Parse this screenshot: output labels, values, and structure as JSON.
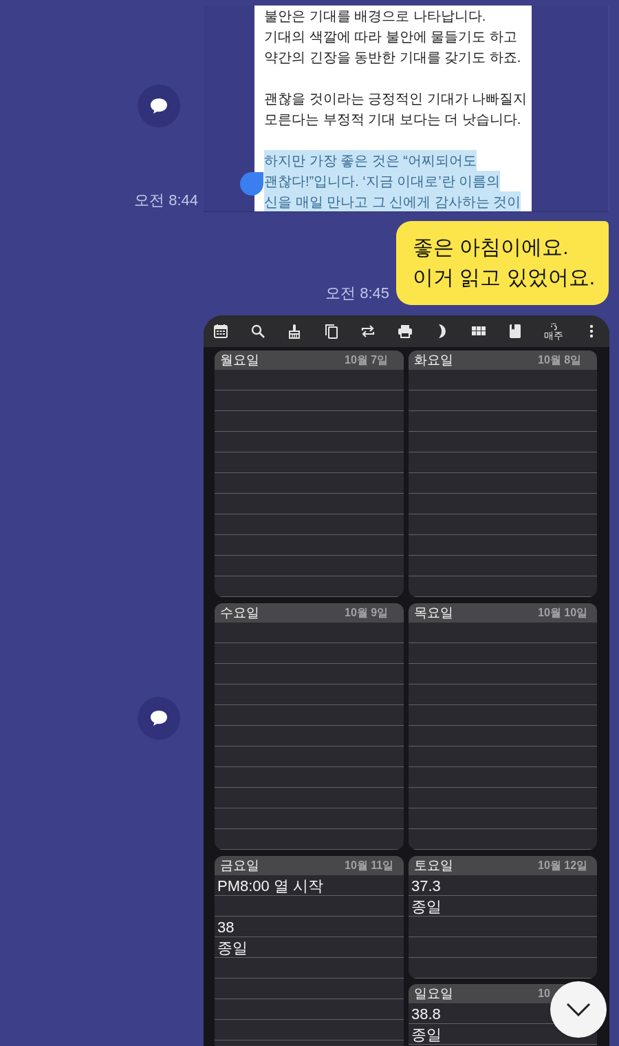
{
  "messages": [
    {
      "kind": "document_image",
      "time": "오전 8:44",
      "paragraphs": [
        {
          "highlighted": false,
          "lines": [
            "불안은 기대를 배경으로 나타납니다.",
            "기대의 색깔에 따라 불안에 물들기도 하고",
            "약간의 긴장을 동반한 기대를 갖기도 하죠."
          ]
        },
        {
          "highlighted": false,
          "lines": [
            "괜찮을 것이라는 긍정적인 기대가 나빠질지",
            "모른다는 부정적 기대 보다는 더 낫습니다."
          ]
        },
        {
          "highlighted": true,
          "lines": [
            "하지만 가장 좋은 것은 “어찌되어도",
            "괜찮다!”입니다. ‘지금 이대로’란 이름의",
            "신을 매일 만나고 그 신에게 감사하는 것이"
          ]
        }
      ]
    },
    {
      "kind": "text",
      "time": "오전 8:45",
      "text": "좋은 아침이에요.\n이거 읽고 있었어요."
    },
    {
      "kind": "calendar_image",
      "toolbar": {
        "repeat_label": "매주"
      },
      "days": [
        {
          "name": "월요일",
          "date": "10월 7일"
        },
        {
          "name": "화요일",
          "date": "10월 8일"
        },
        {
          "name": "수요일",
          "date": "10월 9일"
        },
        {
          "name": "목요일",
          "date": "10월 10일"
        },
        {
          "name": "금요일",
          "date": "10월 11일",
          "events": [
            {
              "title": "PM8:00 열 시작"
            },
            {
              "title": "38",
              "time": "종일"
            }
          ]
        },
        {
          "name": "토요일",
          "date": "10월 12일",
          "events": [
            {
              "title": "37.3",
              "time": "종일"
            }
          ]
        },
        {
          "name": "일요일",
          "date": "10",
          "events": [
            {
              "title": "38.8",
              "time": "종일"
            }
          ]
        }
      ]
    }
  ]
}
